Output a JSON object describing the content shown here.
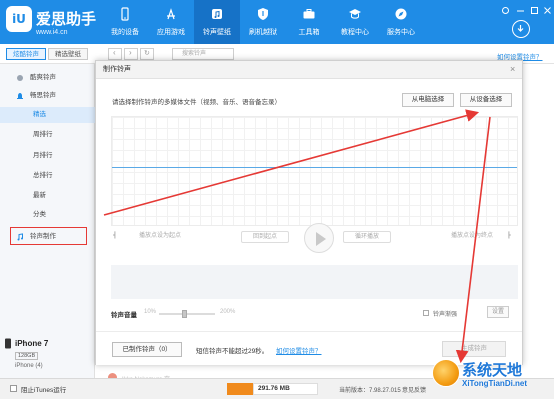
{
  "app": {
    "logo_badge": "iU",
    "logo_name": "爱思助手",
    "logo_url": "www.i4.cn"
  },
  "nav": [
    {
      "label": "我的设备",
      "icon": "phone-icon"
    },
    {
      "label": "应用游戏",
      "icon": "app-store-icon"
    },
    {
      "label": "铃声壁纸",
      "icon": "ringtone-icon",
      "active": true
    },
    {
      "label": "刷机越狱",
      "icon": "shield-icon"
    },
    {
      "label": "工具箱",
      "icon": "toolbox-icon"
    },
    {
      "label": "教程中心",
      "icon": "graduation-cap-icon"
    },
    {
      "label": "服务中心",
      "icon": "compass-icon"
    }
  ],
  "tabs": {
    "ringtone": "炫酷铃声",
    "wallpaper": "精选壁纸"
  },
  "search": {
    "placeholder": "搜索铃声"
  },
  "top_link": "如何设置铃声？",
  "sidebar": {
    "group_cool": "酷爽铃声",
    "group_pop": "畅思铃声",
    "items": [
      "精选",
      "周排行",
      "月排行",
      "总排行",
      "最新",
      "分类"
    ],
    "make_ringtone": "铃声制作"
  },
  "device": {
    "name": "iPhone 7",
    "capacity": "128GB",
    "model": "iPhone (4)"
  },
  "dialog": {
    "title": "制作铃声",
    "description": "请选择制作铃声的多媒体文件（视频、音乐、语音备忘录）",
    "from_pc": "从电脑选择",
    "from_device": "从设备选择",
    "set_start": "播放点设为起点",
    "back_start": "回到起点",
    "loop": "循环播放",
    "set_end": "播放点设为终点",
    "volume_label": "铃声音量",
    "volume_min": "10%",
    "volume_max": "200%",
    "fade": "铃声渐强",
    "settings": "设置",
    "made_ringtones": "已制作铃声（0）",
    "note": "短信铃声不能超过29秒。",
    "how_to": "如何设置铃声？",
    "generate": "生成铃声"
  },
  "background_text": "Ikko Nakamura 夺...",
  "status": {
    "block_itunes": "阻止iTunes运行",
    "memory": "291.76 MB",
    "version": "当前版本：7.98.27.015",
    "feedback": "意见反馈"
  },
  "watermark": {
    "cn": "系统天地",
    "en": "XiTongTianDi.net"
  },
  "colors": {
    "brand": "#1f8ce6",
    "annotation": "#e53935",
    "memory_bar": "#f08a1c"
  }
}
